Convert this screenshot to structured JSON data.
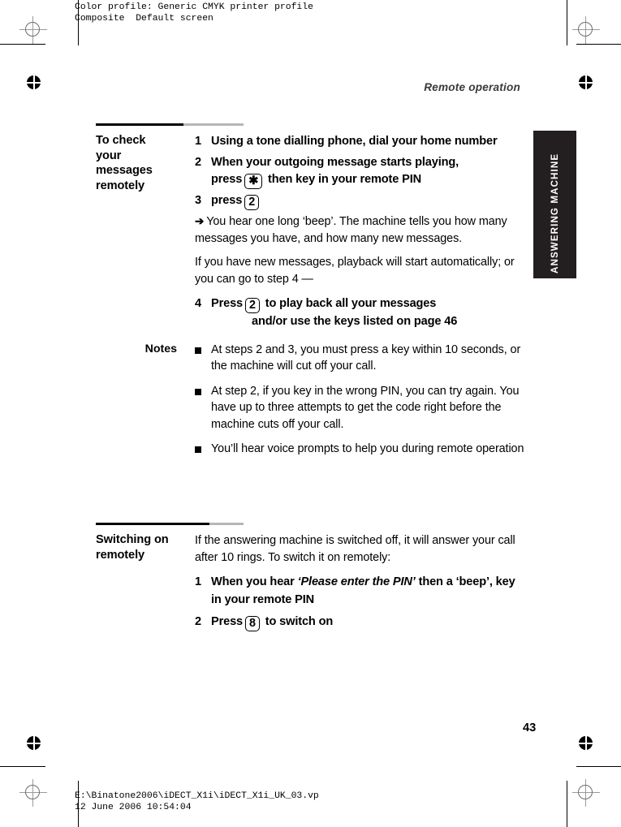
{
  "prepress": {
    "profile_header": "Color profile: Generic CMYK printer profile\nComposite  Default screen",
    "file_footer": "E:\\Binatone2006\\iDECT_X1i\\iDECT_X1i_UK_03.vp\n12 June 2006 10:54:04",
    "marks": {
      "registration_icon": "registration-crosshair-icon",
      "bullseye_icon": "registration-bullseye-icon"
    }
  },
  "page": {
    "running_head": "Remote operation",
    "number": "43",
    "thumb_tab": "ANSWERING MACHINE",
    "colors": {
      "tab_background": "#231f20",
      "rule_black": "#000000",
      "rule_gray": "#b6b6b6",
      "running_head": "#3a3a3a"
    }
  },
  "sections": [
    {
      "heading": "To check\nyour\nmessages\nremotely",
      "steps": [
        {
          "num": "1",
          "text_before": "Using a tone dialling phone, dial your home number",
          "key": null,
          "text_after": ""
        },
        {
          "num": "2",
          "text_before": "When your outgoing message starts playing,\npress",
          "key": "✱",
          "text_after": "then key in your remote PIN"
        },
        {
          "num": "3",
          "text_before": "press",
          "key": "2",
          "text_after": ""
        }
      ],
      "arrow_note": {
        "glyph": "➔",
        "text": "You hear one long ‘beep’. The machine tells you how many messages you have, and how many new messages."
      },
      "follow_para": "If you have new messages, playback will start automatically; or you can go to step 4 —",
      "final_step": {
        "num": "4",
        "text_before": "Press",
        "key": "2",
        "text_after": "to play back all your messages",
        "text_line2": "and/or use the keys listed on page 46"
      },
      "notes_label": "Notes",
      "notes": [
        "At steps 2 and 3, you must press a key within 10 seconds, or the machine will cut off your call.",
        "At step 2, if you key in the wrong PIN, you can try again. You have up to three attempts to get the code right before the machine cuts off your call.",
        "You’ll hear voice prompts to help you during remote operation"
      ]
    },
    {
      "heading": "Switching on\nremotely",
      "intro": "If the answering machine is switched off, it will answer your call after 10 rings. To switch it on remotely:",
      "steps": [
        {
          "num": "1",
          "text_before": "When you hear ",
          "italic": "‘Please enter the PIN’",
          "text_after": " then a ‘beep’, key in your remote PIN",
          "key": null
        },
        {
          "num": "2",
          "text_before": "Press",
          "key": "8",
          "text_after": "to switch on"
        }
      ]
    }
  ]
}
